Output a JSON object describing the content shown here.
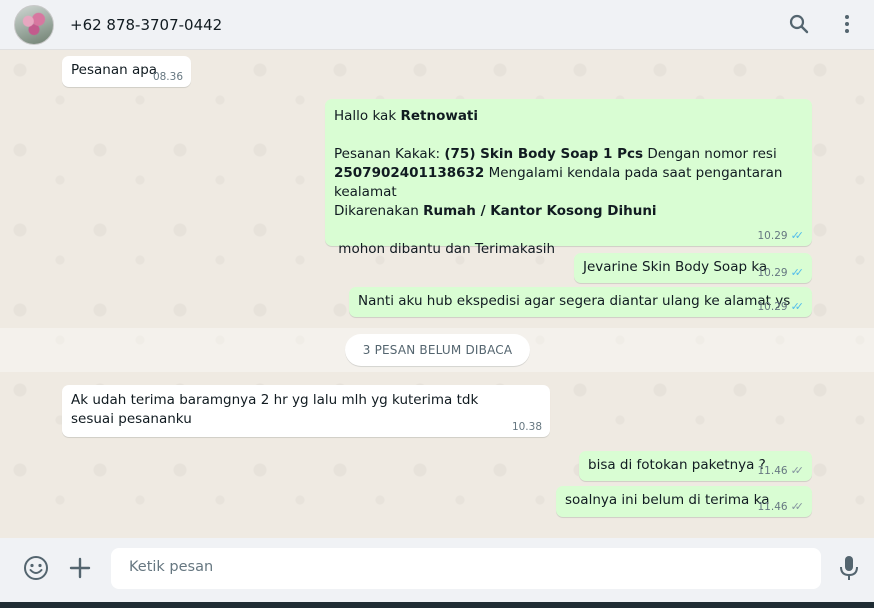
{
  "header": {
    "contact_name": "+62 878-3707-0442",
    "icons": [
      "search-icon",
      "menu-icon"
    ]
  },
  "messages": [
    {
      "direction": "in",
      "text": "Pesanan apa",
      "time": "08.36"
    },
    {
      "direction": "out",
      "time": "10.29",
      "status": "read",
      "greeting": "Hallo kak ",
      "greeting_name": "Retnowati",
      "line1_pre": "Pesanan Kakak: ",
      "product": "(75) Skin Body Soap 1 Pcs",
      "line1_post": " Dengan nomor resi",
      "resi": "2507902401138632",
      "line2_post": " Mengalami kendala pada saat pengantaran kealamat",
      "line3_pre": "Dikarenakan ",
      "reason": "Rumah / Kantor Kosong Dihuni",
      "closing": " mohon dibantu dan Terimakasih"
    },
    {
      "direction": "out",
      "text": "Jevarine Skin Body Soap ka",
      "time": "10.29",
      "status": "read"
    },
    {
      "direction": "out",
      "text": "Nanti aku hub ekspedisi agar segera diantar ulang ke alamat ys",
      "time": "10.29",
      "status": "read"
    },
    {
      "direction": "in",
      "text": "Ak udah terima baramgnya 2 hr yg lalu mlh yg kuterima tdk sesuai pesananku",
      "time": "10.38"
    },
    {
      "direction": "out",
      "text": "bisa di fotokan paketnya ?",
      "time": "11.46",
      "status": "delivered"
    },
    {
      "direction": "out",
      "text": "soalnya ini belum di terima ka",
      "time": "11.46",
      "status": "delivered"
    }
  ],
  "unread_divider": "3 PESAN BELUM DIBACA",
  "composer": {
    "placeholder": "Ketik pesan",
    "icons": [
      "emoji-icon",
      "plus-icon",
      "mic-icon"
    ]
  },
  "colors": {
    "outgoing": "#d9fdd3",
    "incoming": "#ffffff",
    "read_ticks": "#53bdeb",
    "delivered_ticks": "#8696a0"
  }
}
